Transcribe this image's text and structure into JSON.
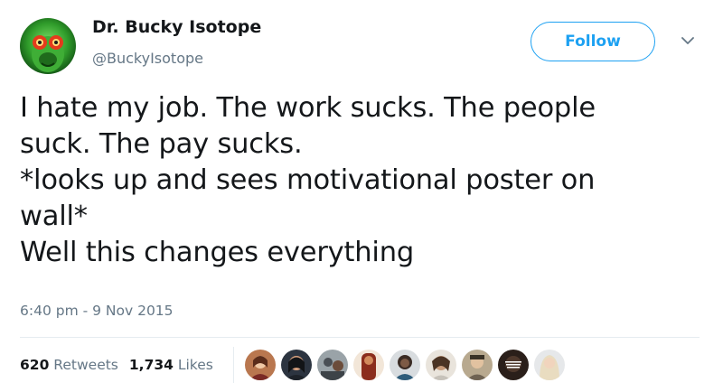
{
  "user": {
    "display_name": "Dr. Bucky Isotope",
    "handle": "@BuckyIsotope",
    "avatar_icon": "profile-avatar"
  },
  "follow_button": {
    "label": "Follow"
  },
  "menu_icon": "chevron-down-icon",
  "tweet": {
    "lines": [
      "I hate my job. The work sucks. The people",
      "suck. The pay sucks.",
      "*looks up and sees motivational poster on",
      "wall*",
      "Well this changes everything"
    ],
    "timestamp": "6:40 pm - 9 Nov 2015"
  },
  "stats": {
    "retweets_count": "620",
    "retweets_label": "Retweets",
    "likes_count": "1,734",
    "likes_label": "Likes"
  },
  "likers": [
    "liker-avatar",
    "liker-avatar",
    "liker-avatar",
    "liker-avatar",
    "liker-avatar",
    "liker-avatar",
    "liker-avatar",
    "liker-avatar",
    "liker-avatar"
  ],
  "colors": {
    "accent": "#1da1f2",
    "secondary_text": "#657786",
    "primary_text": "#14171a",
    "divider": "#e6ecf0"
  }
}
